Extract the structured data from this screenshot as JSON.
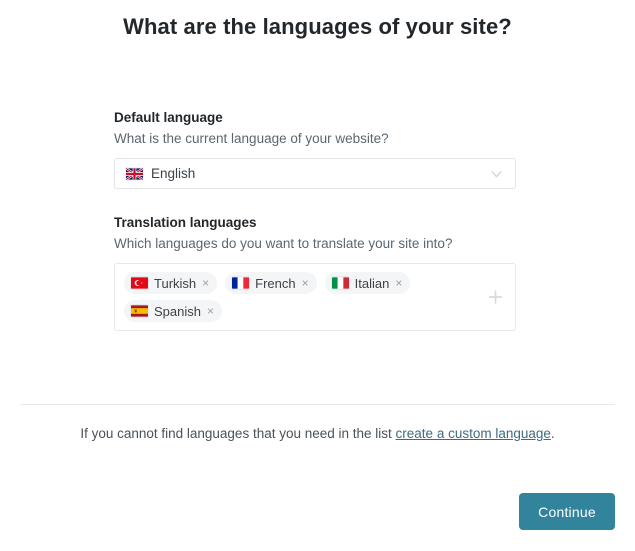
{
  "page": {
    "title": "What are the languages of your site?"
  },
  "default_language": {
    "label": "Default language",
    "hint": "What is the current language of your website?",
    "selected": {
      "name": "English",
      "flag": "uk-flag-icon"
    },
    "chevron_icon": "chevron-down-icon"
  },
  "translation_languages": {
    "label": "Translation languages",
    "hint": "Which languages do you want to translate your site into?",
    "add_icon": "plus-icon",
    "remove_symbol": "×",
    "tags": [
      {
        "name": "Turkish",
        "flag": "turkey-flag-icon"
      },
      {
        "name": "French",
        "flag": "france-flag-icon"
      },
      {
        "name": "Italian",
        "flag": "italy-flag-icon"
      },
      {
        "name": "Spanish",
        "flag": "spain-flag-icon"
      }
    ]
  },
  "footer": {
    "note_prefix": "If you cannot find languages that you need in the list ",
    "link_text": "create a custom language",
    "note_suffix": "."
  },
  "actions": {
    "continue_label": "Continue"
  },
  "colors": {
    "accent": "#31849b",
    "heading": "#22272b",
    "muted": "#5b6670",
    "link": "#3f6b80",
    "border": "#e2e4e7"
  }
}
